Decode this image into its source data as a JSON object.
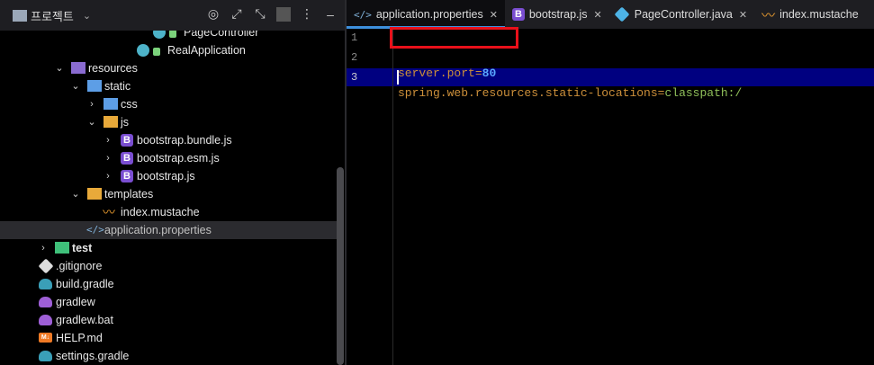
{
  "project_panel": {
    "title": "프로젝트",
    "tools": [
      "target-icon",
      "expand-icon",
      "collapse-icon",
      "more-icon"
    ],
    "tree": [
      {
        "label": "PageController",
        "indent": 204,
        "icon": "class-icon",
        "twisty": ""
      },
      {
        "label": "RealApplication",
        "indent": 186,
        "icon": "spring-class-icon",
        "twisty": ""
      },
      {
        "label": "resources",
        "indent": 98,
        "icon": "resources-folder-icon",
        "twisty": "⌄"
      },
      {
        "label": "static",
        "indent": 116,
        "icon": "web-folder-icon",
        "twisty": "⌄"
      },
      {
        "label": "css",
        "indent": 134,
        "icon": "folder-icon",
        "twisty": "›"
      },
      {
        "label": "js",
        "indent": 134,
        "icon": "js-folder-icon",
        "twisty": "⌄"
      },
      {
        "label": "bootstrap.bundle.js",
        "indent": 152,
        "icon": "bootstrap-icon",
        "twisty": "›"
      },
      {
        "label": "bootstrap.esm.js",
        "indent": 152,
        "icon": "bootstrap-icon",
        "twisty": "›"
      },
      {
        "label": "bootstrap.js",
        "indent": 152,
        "icon": "bootstrap-icon",
        "twisty": "›"
      },
      {
        "label": "templates",
        "indent": 116,
        "icon": "templates-folder-icon",
        "twisty": "⌄"
      },
      {
        "label": "index.mustache",
        "indent": 134,
        "icon": "mustache-icon",
        "twisty": ""
      },
      {
        "label": "application.properties",
        "indent": 116,
        "icon": "properties-icon",
        "twisty": "",
        "selected": true
      },
      {
        "label": "test",
        "indent": 80,
        "icon": "test-folder-icon",
        "twisty": "›",
        "bold": true
      },
      {
        "label": ".gitignore",
        "indent": 62,
        "icon": "git-icon",
        "twisty": ""
      },
      {
        "label": "build.gradle",
        "indent": 62,
        "icon": "gradle-icon",
        "twisty": ""
      },
      {
        "label": "gradlew",
        "indent": 62,
        "icon": "gradlew-icon",
        "twisty": ""
      },
      {
        "label": "gradlew.bat",
        "indent": 62,
        "icon": "gradlew-icon",
        "twisty": ""
      },
      {
        "label": "HELP.md",
        "indent": 62,
        "icon": "markdown-icon",
        "twisty": ""
      },
      {
        "label": "settings.gradle",
        "indent": 62,
        "icon": "gradle-icon",
        "twisty": ""
      }
    ]
  },
  "editor": {
    "tabs": [
      {
        "label": "application.properties",
        "icon": "properties-icon",
        "active": true
      },
      {
        "label": "bootstrap.js",
        "icon": "bootstrap-icon",
        "active": false
      },
      {
        "label": "PageController.java",
        "icon": "java-class-icon",
        "active": false
      },
      {
        "label": "index.mustache",
        "icon": "mustache-icon",
        "active": false
      }
    ],
    "lines": [
      {
        "number": "1",
        "key": "server.port",
        "eq": "=",
        "value": "80"
      },
      {
        "number": "2",
        "key": "spring.web.resources.static-locations",
        "eq": "=",
        "value": "classpath:/"
      },
      {
        "number": "3",
        "key": "",
        "eq": "",
        "value": ""
      }
    ],
    "current_line": 3
  },
  "colors": {
    "accent": "#3d8fdc",
    "highlight_box": "#e8101a",
    "current_line_bg": "#000080",
    "property_key": "#cc8f3a",
    "number_value": "#5aa8ff",
    "string_value": "#8fbf5a"
  }
}
